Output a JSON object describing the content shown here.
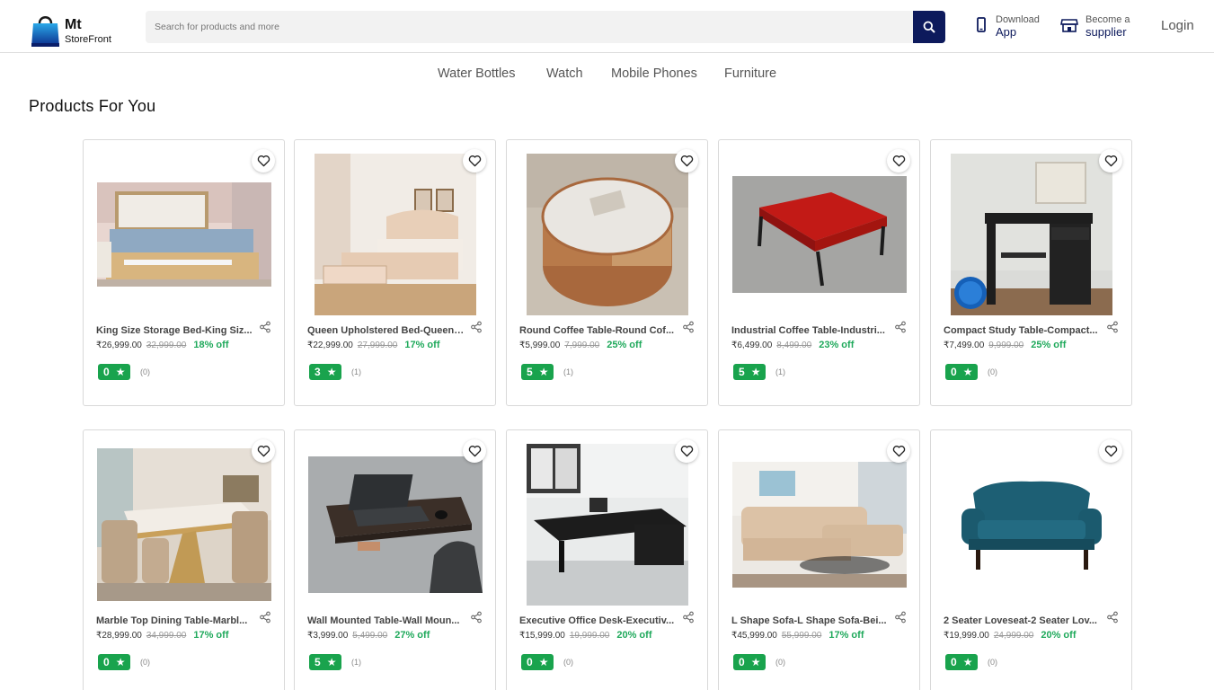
{
  "brand": {
    "line1": "Mt",
    "line2": "StoreFront"
  },
  "search": {
    "placeholder": "Search for products and more"
  },
  "header_actions": {
    "download": {
      "small": "Download",
      "big": "App"
    },
    "supplier": {
      "small": "Become a",
      "big": "supplier"
    },
    "login": "Login"
  },
  "categories": [
    "Water Bottles",
    "Watch",
    "Mobile Phones",
    "Furniture"
  ],
  "section_title": "Products For You",
  "colors": {
    "accent": "#0d1a5c",
    "rating_green": "#19a34d",
    "discount_green": "#1fa95b"
  },
  "products": [
    {
      "title": "King Size Storage Bed-King Siz...",
      "price": "₹26,999.00",
      "mrp": "32,999.00",
      "off": "18% off",
      "rating": "0",
      "count": "(0)"
    },
    {
      "title": "Queen Upholstered Bed-Queen ...",
      "price": "₹22,999.00",
      "mrp": "27,999.00",
      "off": "17% off",
      "rating": "3",
      "count": "(1)"
    },
    {
      "title": "Round Coffee Table-Round Cof...",
      "price": "₹5,999.00",
      "mrp": "7,999.00",
      "off": "25% off",
      "rating": "5",
      "count": "(1)"
    },
    {
      "title": "Industrial Coffee Table-Industri...",
      "price": "₹6,499.00",
      "mrp": "8,499.00",
      "off": "23% off",
      "rating": "5",
      "count": "(1)"
    },
    {
      "title": "Compact Study Table-Compact...",
      "price": "₹7,499.00",
      "mrp": "9,999.00",
      "off": "25% off",
      "rating": "0",
      "count": "(0)"
    },
    {
      "title": "Marble Top Dining Table-Marbl...",
      "price": "₹28,999.00",
      "mrp": "34,999.00",
      "off": "17% off",
      "rating": "0",
      "count": "(0)"
    },
    {
      "title": "Wall Mounted Table-Wall Moun...",
      "price": "₹3,999.00",
      "mrp": "5,499.00",
      "off": "27% off",
      "rating": "5",
      "count": "(1)"
    },
    {
      "title": "Executive Office Desk-Executiv...",
      "price": "₹15,999.00",
      "mrp": "19,999.00",
      "off": "20% off",
      "rating": "0",
      "count": "(0)"
    },
    {
      "title": "L Shape Sofa-L Shape Sofa-Bei...",
      "price": "₹45,999.00",
      "mrp": "55,999.00",
      "off": "17% off",
      "rating": "0",
      "count": "(0)"
    },
    {
      "title": "2 Seater Loveseat-2 Seater Lov...",
      "price": "₹19,999.00",
      "mrp": "24,999.00",
      "off": "20% off",
      "rating": "0",
      "count": "(0)"
    }
  ]
}
